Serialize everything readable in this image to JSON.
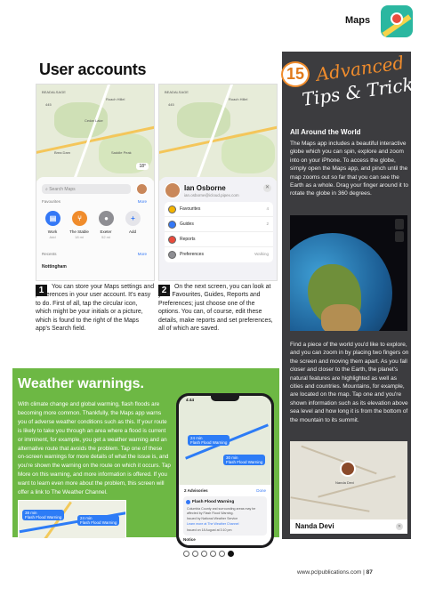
{
  "header": {
    "section": "Maps"
  },
  "heading": "User accounts",
  "shot1": {
    "map_labels": [
      "BEADALSAGE",
      "445",
      "Roach Hillel",
      "Cedar Lake",
      "Brea Dam",
      "Saddle Peak"
    ],
    "temp": "18°",
    "search_placeholder": "Search Maps",
    "favourites": "Favourites",
    "more": "More",
    "favs": [
      {
        "name": "Work",
        "sub": "Add",
        "color": "#3478f6",
        "icon": "briefcase-icon"
      },
      {
        "name": "The Stable",
        "sub": "18 mi",
        "color": "#f08c2c",
        "icon": "fork-knife-icon"
      },
      {
        "name": "Exeter",
        "sub": "52 mi",
        "color": "#8e8e93",
        "icon": "pin-icon"
      },
      {
        "name": "Add",
        "sub": "",
        "color": "#e5e5ea",
        "icon": "plus-icon"
      }
    ],
    "recents": "Recents",
    "recents_more": "More",
    "recent_item": "Nottingham"
  },
  "shot2": {
    "map_labels": [
      "BEADALSAGE",
      "445",
      "Roach Hillel"
    ],
    "name": "Ian Osborne",
    "email": "ian.osborne@icloud.pipex.com",
    "items": [
      {
        "label": "Favourites",
        "right": "4",
        "color": "#f4b400",
        "icon": "star-icon"
      },
      {
        "label": "Guides",
        "right": "2",
        "color": "#3478f6",
        "icon": "guides-icon"
      },
      {
        "label": "Reports",
        "right": "",
        "color": "#e94b3c",
        "icon": "report-icon"
      },
      {
        "label": "Preferences",
        "right": "Walking",
        "color": "#8e8e93",
        "icon": "preferences-icon"
      }
    ]
  },
  "step1": {
    "number": "1",
    "text": "You can store your Maps settings and preferences in your user account. It's easy to do. First of all, tap the circular icon, which might be your initials or a picture, which is found to the right of the Maps app's Search field."
  },
  "step2": {
    "number": "2",
    "text": "On the next screen, you can look at your Favourites, Guides, Reports and Preferences; just choose one of the options. You can, of course, edit these details, make reports and set preferences, all of which are saved."
  },
  "tips": {
    "number": "15",
    "line1": "Advanced",
    "line2": "Tips & Tricks",
    "subheading": "All Around the World",
    "para1": "The Maps app includes a beautiful interactive globe which you can spin, explore and zoom into on your iPhone. To access the globe, simply open the Maps app, and pinch until the map zooms out so far that you can see the Earth as a whole. Drag your finger around it to rotate the globe in 360 degrees.",
    "para2": "Find a piece of the world you'd like to explore, and you can zoom in by placing two fingers on the screen and moving them apart. As you fall closer and closer to the Earth, the planet's natural features are highlighted as well as cities and countries. Mountains, for example, are located on the map. Tap one and you're shown information such as its elevation above sea level and how long it is from the bottom of the mountain to its summit.",
    "mountain_label": "Nanda Devi",
    "mountain_card": "Nanda Devi"
  },
  "weather": {
    "title": "Weather warnings.",
    "text": "With climate change and global warming, flash floods are becoming more common. Thankfully, the Maps app warns you of adverse weather conditions such as this. If your route is likely to take you through an area where a flood is current or imminent, for example, you get a weather warning and an alternative route that avoids the problem. Tap one of these on-screen warnings for more details of what the issue is, and you're shown the warning on the route on which it occurs. Tap More on this warning, and more information is offered. If you want to learn even more about the problem, this screen will offer a link to The Weather Channel.",
    "map_pills": [
      "38 min",
      "24 min"
    ],
    "map_pill_sub": [
      "Flash Flood Warning",
      "Flash Flood Warning"
    ],
    "phone_time": "4:44",
    "phone_pills": [
      "24 min",
      "30 min"
    ],
    "phone_pill_sub": [
      "Flash Flood Warning",
      "Flash Flood Warning"
    ],
    "advisories": "2 Advisories",
    "done": "Done",
    "card_title": "Flash Flood Warning",
    "card_lines": [
      "Columbia County and surrounding areas may be affected by Flash Flood Warning.",
      "Issued by National Weather Service",
      "Learn more at The Weather Channel",
      "Issued on 18 August at 3:10 pm"
    ],
    "notice": "Notice"
  },
  "footer": {
    "site": "www.pclpublications.com",
    "sep": "|",
    "page": "87"
  }
}
